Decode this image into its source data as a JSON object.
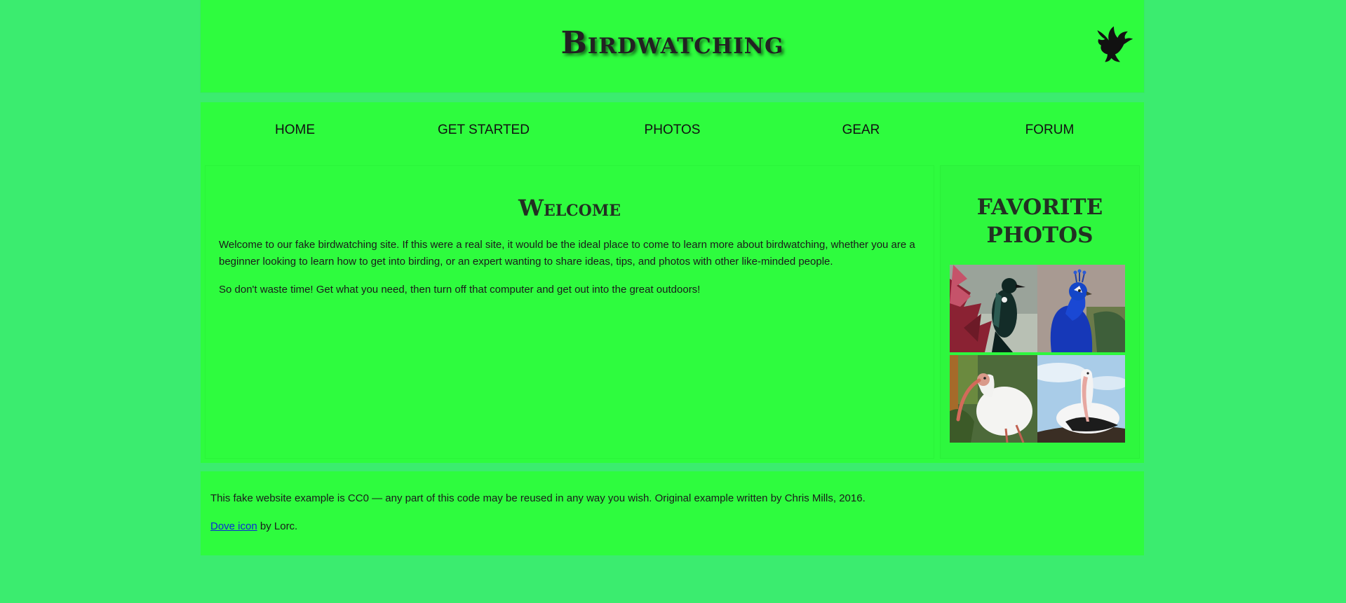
{
  "header": {
    "site_title": "Birdwatching",
    "logo_icon": "dove-icon"
  },
  "nav": {
    "items": [
      "HOME",
      "GET STARTED",
      "PHOTOS",
      "GEAR",
      "FORUM"
    ]
  },
  "article": {
    "heading": "Welcome",
    "paragraphs": [
      "Welcome to our fake birdwatching site. If this were a real site, it would be the ideal place to come to learn more about birdwatching, whether you are a beginner looking to learn how to get into birding, or an expert wanting to share ideas, tips, and photos with other like-minded people.",
      "So don't waste time! Get what you need, then turn off that computer and get out into the great outdoors!"
    ]
  },
  "aside": {
    "heading_line1": "Favorite",
    "heading_line2": "photos",
    "photos": [
      "tui-photo",
      "peacock-photo",
      "ibis-photo",
      "pelican-photo"
    ]
  },
  "footer": {
    "license_text": "This fake website example is CC0 — any part of this code may be reused in any way you wish. Original example written by Chris Mills, 2016.",
    "credit_link": "Dove icon",
    "credit_suffix": " by Lorc."
  },
  "colors": {
    "page_bg": "#3bec6f",
    "panel_bg": "#2efc3e",
    "text": "#111111",
    "link": "#0a2bd6"
  }
}
